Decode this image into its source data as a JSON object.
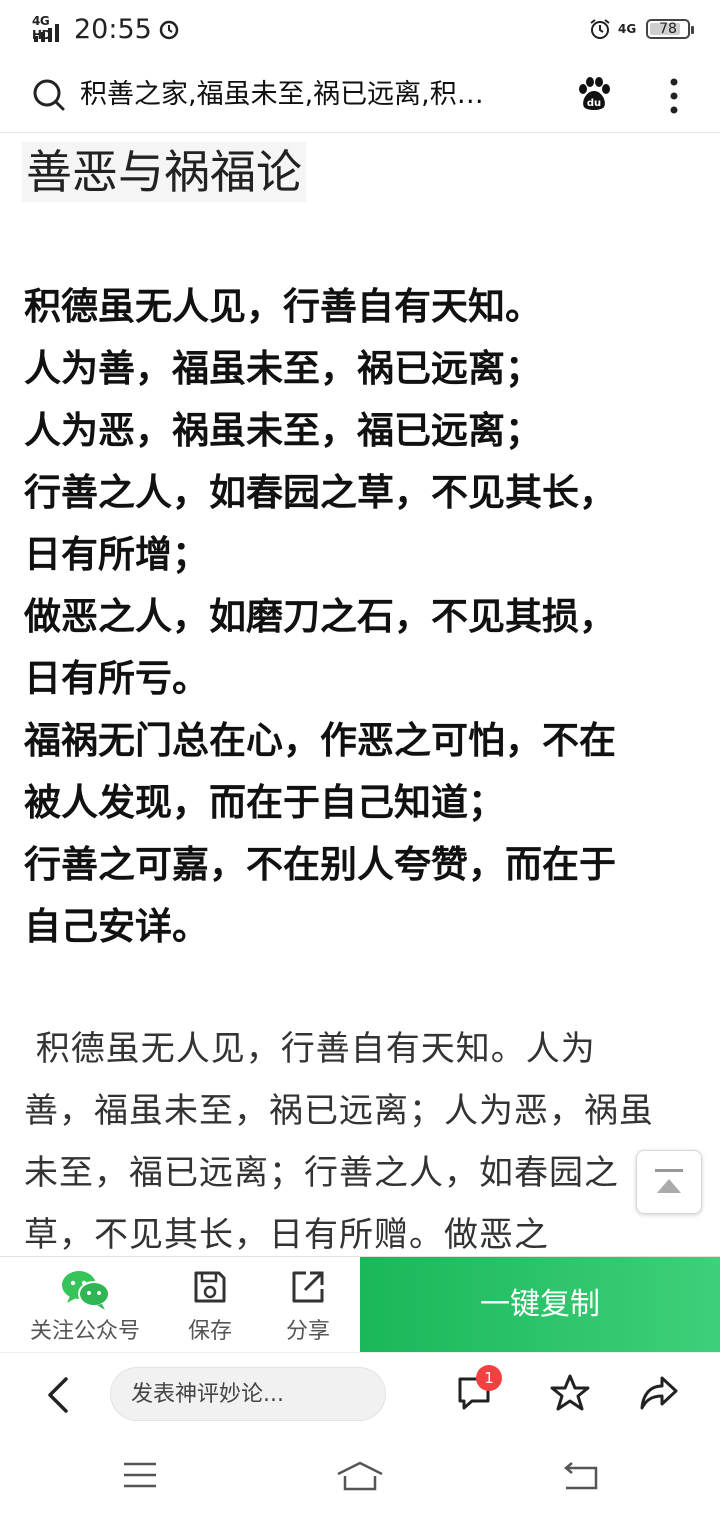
{
  "status_bar": {
    "network": "4G HD",
    "time": "20:55",
    "network_right": "4G",
    "battery": "78"
  },
  "search": {
    "query": "积善之家,福虽未至,祸已远离,积…"
  },
  "article": {
    "title": "善恶与祸福论",
    "verse_lines": [
      "积德虽无人见，行善自有天知。",
      "人为善，福虽未至，祸已远离；",
      "人为恶，祸虽未至，福已远离；",
      "行善之人，如春园之草，不见其长，",
      "日有所增；",
      "做恶之人，如磨刀之石，不见其损，",
      "日有所亏。",
      "福祸无门总在心，作恶之可怕，不在",
      "被人发现，而在于自己知道；",
      "行善之可嘉，不在别人夸赞，而在于",
      "自己安详。"
    ],
    "prose_lines": [
      " 积德虽无人见，行善自有天知。人为",
      "善，福虽未至，祸已远离；人为恶，祸虽",
      "未至，福已远离；行善之人，如春园之",
      "草，不见其长，日有所赠。做恶之"
    ]
  },
  "actions": {
    "follow_label": "关注公众号",
    "save_label": "保存",
    "share_label": "分享",
    "copy_label": "一键复制"
  },
  "bottom_bar": {
    "comment_placeholder": "发表神评妙论...",
    "comment_count": "1"
  },
  "colors": {
    "accent_green": "#1ab75a",
    "badge_red": "#f24141"
  }
}
